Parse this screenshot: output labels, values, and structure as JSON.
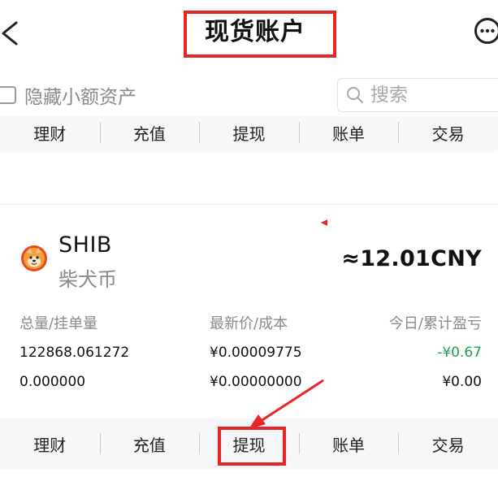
{
  "header": {
    "title": "现货账户",
    "back_icon": "chevron-left-icon",
    "more_icon": "more-horizontal-circle-icon"
  },
  "filter": {
    "hide_small_label": "隐藏小额资产",
    "hide_small_checked": false,
    "search_placeholder": "搜索",
    "search_value": ""
  },
  "actions": {
    "wealth": "理财",
    "deposit": "充值",
    "withdraw": "提现",
    "bill": "账单",
    "trade": "交易"
  },
  "coin": {
    "symbol": "SHIB",
    "name": "柴犬币",
    "value": "≈12.01CNY",
    "logo_icon": "shiba-inu-logo-icon"
  },
  "table": {
    "headers": [
      "总量/挂单量",
      "最新价/成本",
      "今日/累计盈亏"
    ],
    "rows": [
      [
        "122868.061272",
        "¥0.00009775",
        "-¥0.67"
      ],
      [
        "0.000000",
        "¥0.00000000",
        "¥0.00"
      ]
    ]
  },
  "colors": {
    "annotation_red": "#e8262a",
    "negative_pnl_green": "#1aa34a",
    "muted_text": "#8a8a8a"
  }
}
